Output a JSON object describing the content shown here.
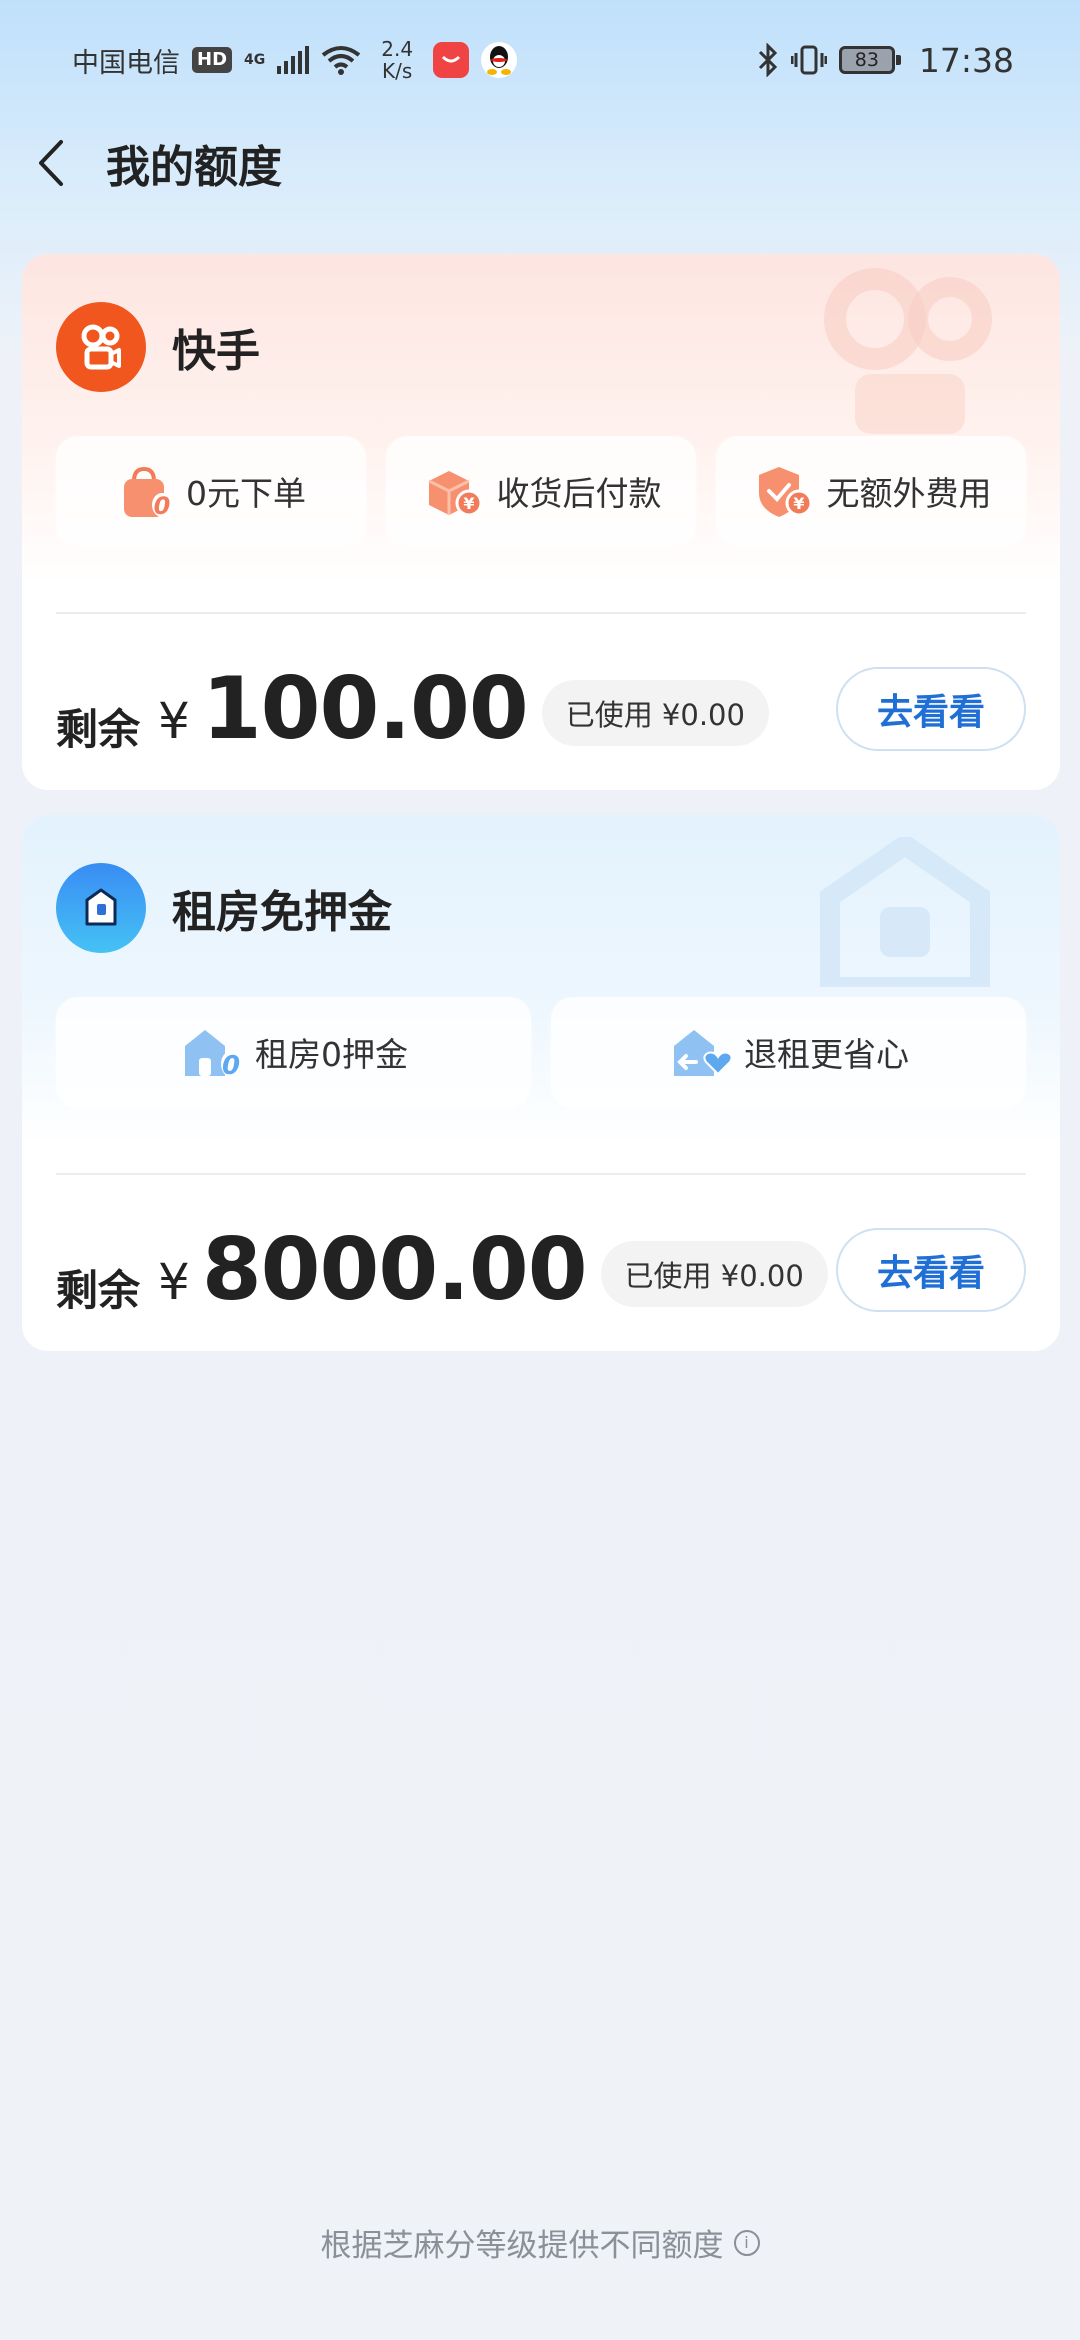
{
  "status_bar": {
    "carrier": "中国电信",
    "hd": "HD",
    "network": "4G",
    "net_speed_value": "2.4",
    "net_speed_unit": "K/s",
    "battery": "83",
    "time": "17:38"
  },
  "header": {
    "title": "我的额度"
  },
  "cards": [
    {
      "name": "快手",
      "features": [
        {
          "label": "0元下单",
          "icon": "shopping-bag-icon"
        },
        {
          "label": "收货后付款",
          "icon": "package-yen-icon"
        },
        {
          "label": "无额外费用",
          "icon": "shield-yen-icon"
        }
      ],
      "remain_label": "剩余",
      "currency": "¥",
      "amount": "100.00",
      "used": "已使用 ¥0.00",
      "button": "去看看",
      "accent": "#f0561e"
    },
    {
      "name": "租房免押金",
      "features": [
        {
          "label": "租房0押金",
          "icon": "house-zero-icon"
        },
        {
          "label": "退租更省心",
          "icon": "house-heart-icon"
        }
      ],
      "remain_label": "剩余",
      "currency": "¥",
      "amount": "8000.00",
      "used": "已使用 ¥0.00",
      "button": "去看看",
      "accent": "#3a8cf3"
    }
  ],
  "footer": {
    "note": "根据芝麻分等级提供不同额度"
  },
  "colors": {
    "link_blue": "#1f6fd6",
    "card_bg": "#ffffff",
    "page_bg": "#eff2f7"
  }
}
